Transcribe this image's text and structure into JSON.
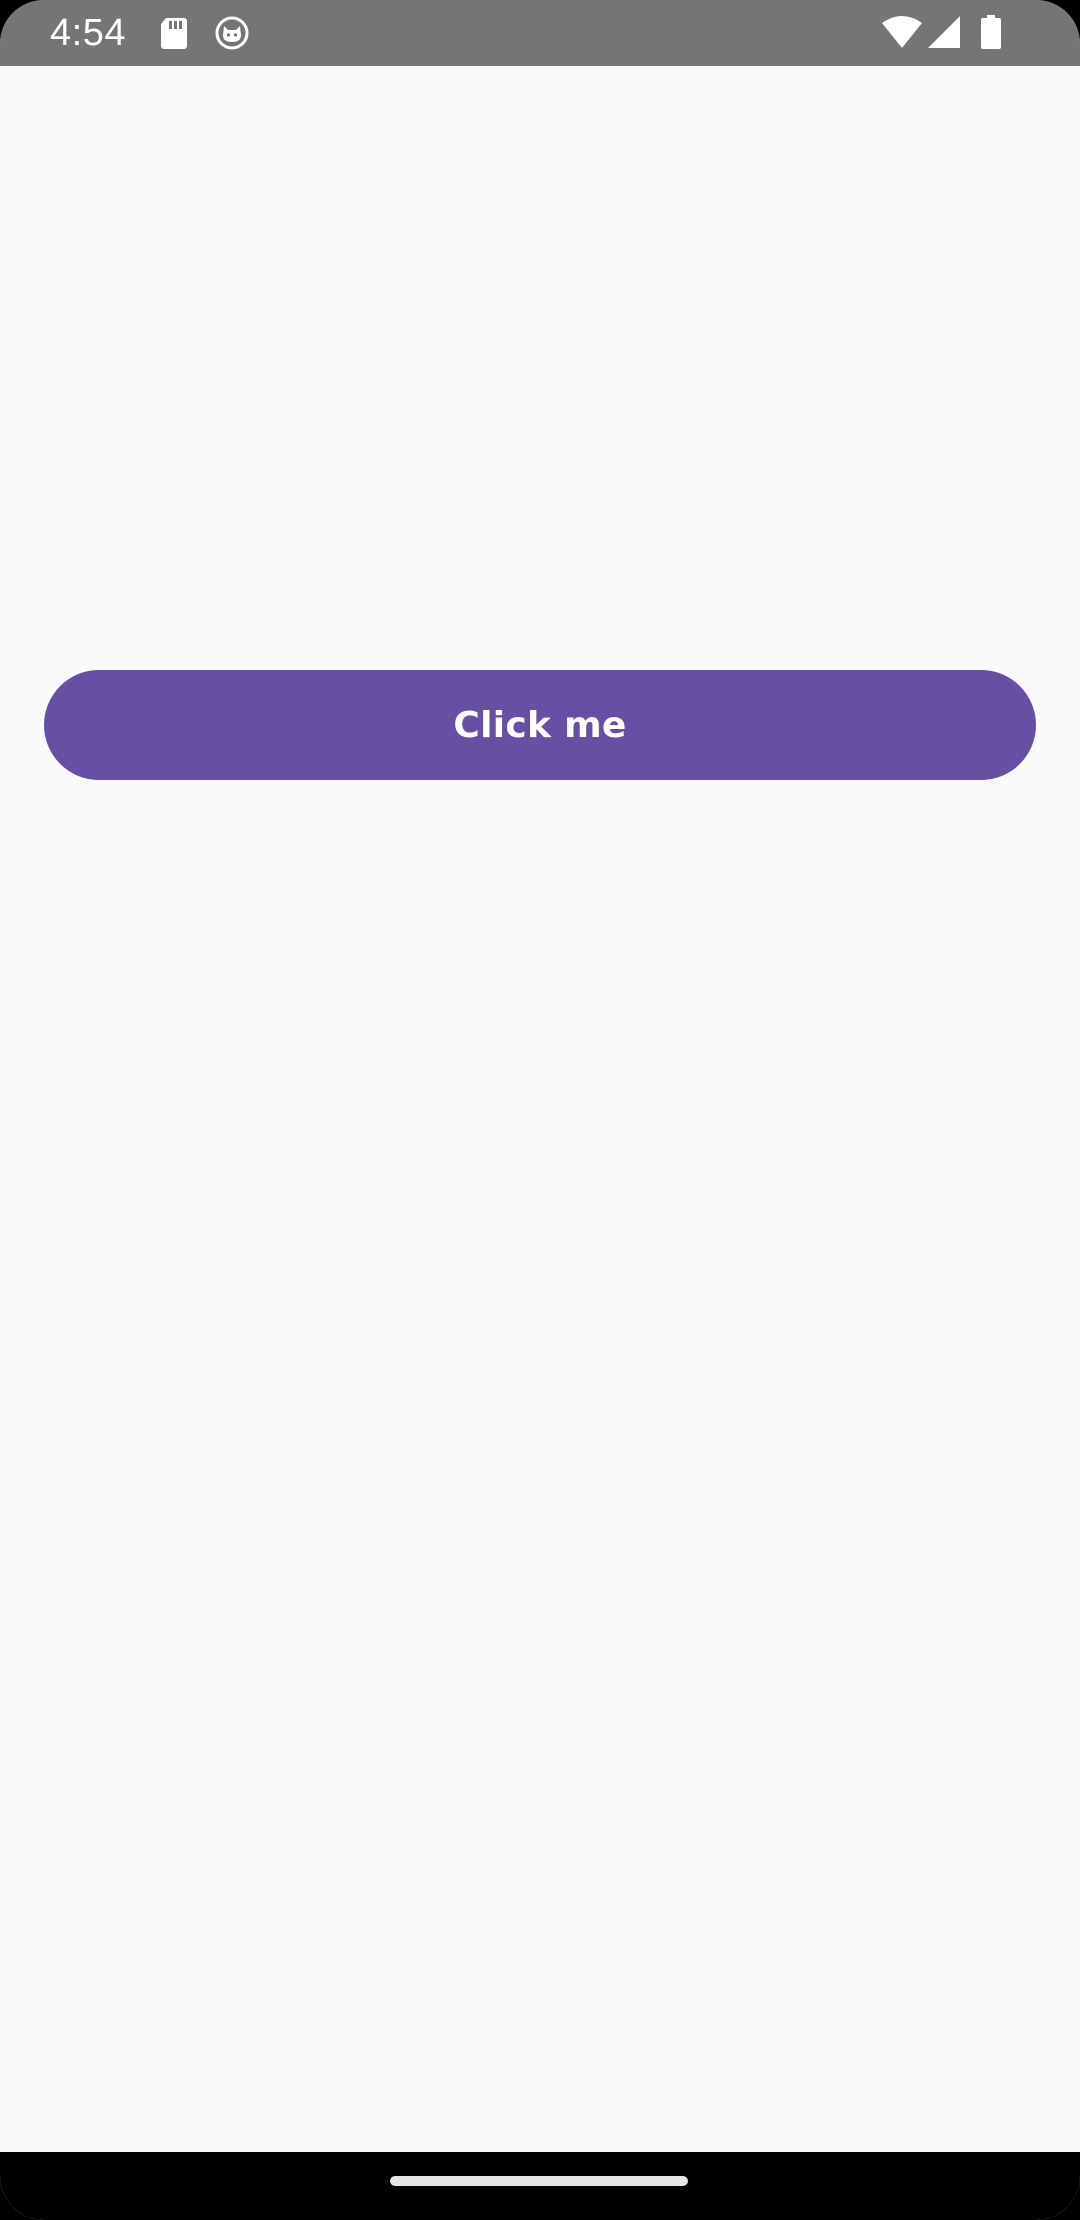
{
  "status_bar": {
    "time": "4:54",
    "left_icons": [
      "sd-card-icon",
      "cat-face-icon"
    ],
    "right_icons": [
      "wifi-icon",
      "cell-signal-icon",
      "battery-icon"
    ],
    "background_color": "#757575"
  },
  "main": {
    "button_label": "Click me",
    "button_color": "#6750A4",
    "background_color": "#FAFAFA"
  },
  "nav_bar": {
    "gesture": "home-handle",
    "background_color": "#000000"
  }
}
